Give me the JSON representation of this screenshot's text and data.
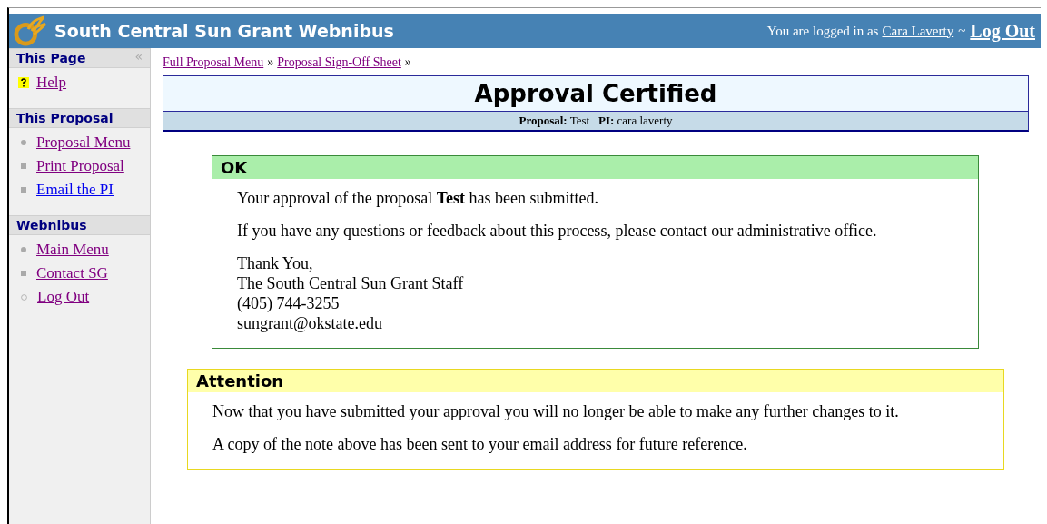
{
  "header": {
    "title": "South Central Sun Grant Webnibus",
    "login_prefix": "You are logged in as",
    "user": "Cara Laverty",
    "separator": "~",
    "logout": "Log Out"
  },
  "sidebar": {
    "collapse": "«",
    "sections": [
      {
        "title": "This Page",
        "items": [
          {
            "label": "Help",
            "kind": "help",
            "visited": true
          }
        ]
      },
      {
        "title": "This Proposal",
        "items": [
          {
            "label": "Proposal Menu",
            "kind": "disc",
            "visited": true
          },
          {
            "label": "Print Proposal",
            "kind": "square",
            "visited": true
          },
          {
            "label": "Email the PI",
            "kind": "square",
            "visited": false
          }
        ]
      },
      {
        "title": "Webnibus",
        "items": [
          {
            "label": "Main Menu",
            "kind": "disc",
            "visited": true
          },
          {
            "label": "Contact SG",
            "kind": "square",
            "visited": true
          },
          {
            "label": "Log Out",
            "kind": "circle",
            "visited": true
          }
        ]
      }
    ]
  },
  "breadcrumbs": [
    {
      "label": "Full Proposal Menu"
    },
    {
      "label": "Proposal Sign-Off Sheet"
    }
  ],
  "breadcrumb_separator": "»",
  "page_title": "Approval Certified",
  "proposal_info": "**Proposal:** Test   **PI:** cara laverty",
  "messages": [
    {
      "kind": "ok",
      "title": "OK",
      "paragraphs": [
        [
          "Your approval of the proposal **Test** has been submitted."
        ],
        [
          "If you have any questions or feedback about this process, please contact our administrative office."
        ],
        [
          "Thank You,",
          "The South Central Sun Grant Staff",
          "(405) 744-3255",
          "sungrant@okstate.edu"
        ]
      ]
    },
    {
      "kind": "attention",
      "title": "Attention",
      "paragraphs": [
        [
          "Now that you have submitted your approval you will no longer be able to make any further changes to it."
        ],
        [
          "A copy of the note above has been sent to your email address for future reference."
        ]
      ]
    }
  ]
}
